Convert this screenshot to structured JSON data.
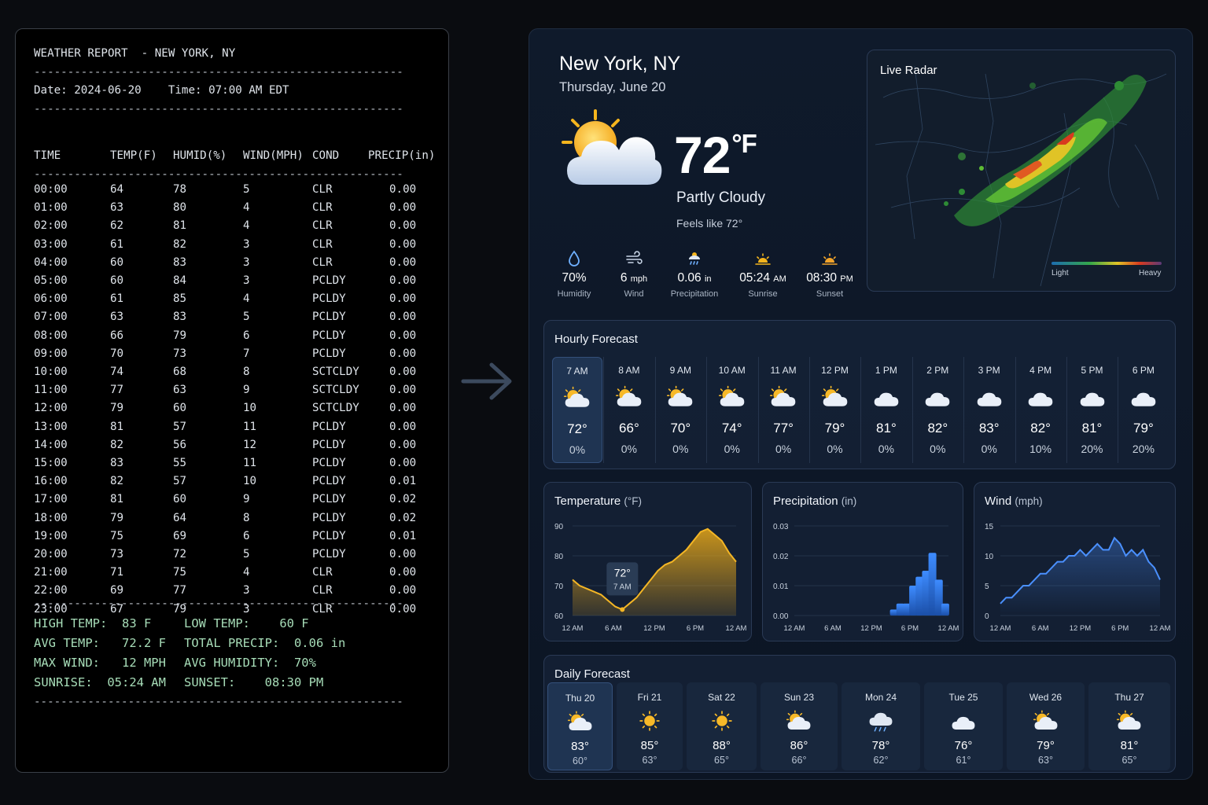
{
  "terminal": {
    "title": "WEATHER REPORT  - NEW YORK, NY",
    "separator": "-------------------------------------------------------",
    "date_line": "Date: 2024-06-20    Time: 07:00 AM EDT",
    "headers": [
      "TIME",
      "TEMP(F)",
      "HUMID(%)",
      "WIND(MPH)",
      "COND",
      "PRECIP(in)"
    ],
    "rows": [
      [
        "00:00",
        "64",
        "78",
        "5",
        "CLR",
        "0.00"
      ],
      [
        "01:00",
        "63",
        "80",
        "4",
        "CLR",
        "0.00"
      ],
      [
        "02:00",
        "62",
        "81",
        "4",
        "CLR",
        "0.00"
      ],
      [
        "03:00",
        "61",
        "82",
        "3",
        "CLR",
        "0.00"
      ],
      [
        "04:00",
        "60",
        "83",
        "3",
        "CLR",
        "0.00"
      ],
      [
        "05:00",
        "60",
        "84",
        "3",
        "PCLDY",
        "0.00"
      ],
      [
        "06:00",
        "61",
        "85",
        "4",
        "PCLDY",
        "0.00"
      ],
      [
        "07:00",
        "63",
        "83",
        "5",
        "PCLDY",
        "0.00"
      ],
      [
        "08:00",
        "66",
        "79",
        "6",
        "PCLDY",
        "0.00"
      ],
      [
        "09:00",
        "70",
        "73",
        "7",
        "PCLDY",
        "0.00"
      ],
      [
        "10:00",
        "74",
        "68",
        "8",
        "SCTCLDY",
        "0.00"
      ],
      [
        "11:00",
        "77",
        "63",
        "9",
        "SCTCLDY",
        "0.00"
      ],
      [
        "12:00",
        "79",
        "60",
        "10",
        "SCTCLDY",
        "0.00"
      ],
      [
        "13:00",
        "81",
        "57",
        "11",
        "PCLDY",
        "0.00"
      ],
      [
        "14:00",
        "82",
        "56",
        "12",
        "PCLDY",
        "0.00"
      ],
      [
        "15:00",
        "83",
        "55",
        "11",
        "PCLDY",
        "0.00"
      ],
      [
        "16:00",
        "82",
        "57",
        "10",
        "PCLDY",
        "0.01"
      ],
      [
        "17:00",
        "81",
        "60",
        "9",
        "PCLDY",
        "0.02"
      ],
      [
        "18:00",
        "79",
        "64",
        "8",
        "PCLDY",
        "0.02"
      ],
      [
        "19:00",
        "75",
        "69",
        "6",
        "PCLDY",
        "0.01"
      ],
      [
        "20:00",
        "73",
        "72",
        "5",
        "PCLDY",
        "0.00"
      ],
      [
        "21:00",
        "71",
        "75",
        "4",
        "CLR",
        "0.00"
      ],
      [
        "22:00",
        "69",
        "77",
        "3",
        "CLR",
        "0.00"
      ],
      [
        "23:00",
        "67",
        "79",
        "3",
        "CLR",
        "0.00"
      ]
    ],
    "summary": [
      [
        "HIGH TEMP:  83 F",
        "LOW TEMP:    60 F"
      ],
      [
        "AVG TEMP:   72.2 F",
        "TOTAL PRECIP:  0.06 in"
      ],
      [
        "MAX WIND:   12 MPH",
        "AVG HUMIDITY:  70%"
      ],
      [
        "SUNRISE:  05:24 AM",
        "SUNSET:    08:30 PM"
      ]
    ]
  },
  "current": {
    "city": "New York, NY",
    "date": "Thursday, June 20",
    "temp": "72",
    "temp_unit": "°F",
    "condition": "Partly Cloudy",
    "feels_like": "Feels like 72°",
    "icon": "partly-cloudy-icon",
    "stats": [
      {
        "icon": "humidity-icon",
        "value": "70%",
        "unit": "",
        "label": "Humidity"
      },
      {
        "icon": "wind-icon",
        "value": "6",
        "unit": "mph",
        "label": "Wind"
      },
      {
        "icon": "precipitation-icon",
        "value": "0.06",
        "unit": "in",
        "label": "Precipitation"
      },
      {
        "icon": "sunrise-icon",
        "value": "05:24",
        "unit": "AM",
        "label": "Sunrise"
      },
      {
        "icon": "sunset-icon",
        "value": "08:30",
        "unit": "PM",
        "label": "Sunset"
      }
    ]
  },
  "radar": {
    "title": "Live Radar",
    "legend_light": "Light",
    "legend_heavy": "Heavy"
  },
  "hourly": {
    "title": "Hourly Forecast",
    "items": [
      {
        "time": "7 AM",
        "temp": "72°",
        "precip": "0%",
        "icon": "partly-cloudy-icon"
      },
      {
        "time": "8 AM",
        "temp": "66°",
        "precip": "0%",
        "icon": "partly-cloudy-icon"
      },
      {
        "time": "9 AM",
        "temp": "70°",
        "precip": "0%",
        "icon": "partly-cloudy-icon"
      },
      {
        "time": "10 AM",
        "temp": "74°",
        "precip": "0%",
        "icon": "partly-cloudy-icon"
      },
      {
        "time": "11 AM",
        "temp": "77°",
        "precip": "0%",
        "icon": "partly-cloudy-icon"
      },
      {
        "time": "12 PM",
        "temp": "79°",
        "precip": "0%",
        "icon": "partly-cloudy-icon"
      },
      {
        "time": "1 PM",
        "temp": "81°",
        "precip": "0%",
        "icon": "cloudy-icon"
      },
      {
        "time": "2 PM",
        "temp": "82°",
        "precip": "0%",
        "icon": "cloudy-icon"
      },
      {
        "time": "3 PM",
        "temp": "83°",
        "precip": "0%",
        "icon": "cloudy-icon"
      },
      {
        "time": "4 PM",
        "temp": "82°",
        "precip": "10%",
        "icon": "cloudy-icon"
      },
      {
        "time": "5 PM",
        "temp": "81°",
        "precip": "20%",
        "icon": "cloudy-icon"
      },
      {
        "time": "6 PM",
        "temp": "79°",
        "precip": "20%",
        "icon": "cloudy-icon"
      }
    ]
  },
  "charts": {
    "temperature": {
      "title": "Temperature",
      "unit": "(°F)",
      "tooltip_value": "72°",
      "tooltip_time": "7 AM"
    },
    "precipitation": {
      "title": "Precipitation",
      "unit": "(in)"
    },
    "wind": {
      "title": "Wind",
      "unit": "(mph)"
    }
  },
  "chart_data": [
    {
      "type": "area",
      "title": "Temperature (°F)",
      "x": [
        "00:00",
        "01:00",
        "02:00",
        "03:00",
        "04:00",
        "05:00",
        "06:00",
        "07:00",
        "08:00",
        "09:00",
        "10:00",
        "11:00",
        "12:00",
        "13:00",
        "14:00",
        "15:00",
        "16:00",
        "17:00",
        "18:00",
        "19:00",
        "20:00",
        "21:00",
        "22:00",
        "23:00"
      ],
      "values": [
        72,
        70,
        69,
        68,
        67,
        65,
        63,
        62,
        64,
        66,
        69,
        72,
        75,
        77,
        78,
        80,
        82,
        85,
        88,
        89,
        87,
        85,
        81,
        78
      ],
      "ylim": [
        60,
        90
      ],
      "yticks": [
        "90",
        "80",
        "70",
        "60"
      ],
      "xticks": [
        "12 AM",
        "6 AM",
        "12 PM",
        "6 PM",
        "12 AM"
      ],
      "color": "#e8a818"
    },
    {
      "type": "bar",
      "title": "Precipitation (in)",
      "x": [
        "15:00",
        "16:00",
        "17:00",
        "18:00",
        "19:00",
        "20:00",
        "21:00",
        "22:00",
        "23:00"
      ],
      "values": [
        0.002,
        0.004,
        0.004,
        0.01,
        0.013,
        0.015,
        0.021,
        0.012,
        0.004
      ],
      "ylim": [
        0,
        0.03
      ],
      "yticks": [
        "0.03",
        "0.02",
        "0.01",
        "0.00"
      ],
      "xticks": [
        "12 AM",
        "6 AM",
        "12 PM",
        "6 PM",
        "12 AM"
      ],
      "color": "#2f7df0"
    },
    {
      "type": "line",
      "title": "Wind (mph)",
      "values": [
        2,
        3,
        3,
        4,
        5,
        5,
        6,
        7,
        7,
        8,
        9,
        9,
        10,
        10,
        11,
        10,
        11,
        12,
        11,
        11,
        13,
        12,
        10,
        11,
        10,
        11,
        9,
        8,
        6
      ],
      "ylim": [
        0,
        15
      ],
      "yticks": [
        "15",
        "10",
        "5",
        "0"
      ],
      "xticks": [
        "12 AM",
        "6 AM",
        "12 PM",
        "6 PM",
        "12 AM"
      ],
      "color": "#4a90ff"
    }
  ],
  "daily": {
    "title": "Daily Forecast",
    "items": [
      {
        "day": "Thu 20",
        "hi": "83°",
        "lo": "60°",
        "icon": "partly-cloudy-icon"
      },
      {
        "day": "Fri 21",
        "hi": "85°",
        "lo": "63°",
        "icon": "sunny-icon"
      },
      {
        "day": "Sat 22",
        "hi": "88°",
        "lo": "65°",
        "icon": "sunny-icon"
      },
      {
        "day": "Sun 23",
        "hi": "86°",
        "lo": "66°",
        "icon": "partly-cloudy-icon"
      },
      {
        "day": "Mon 24",
        "hi": "78°",
        "lo": "62°",
        "icon": "rain-icon"
      },
      {
        "day": "Tue 25",
        "hi": "76°",
        "lo": "61°",
        "icon": "cloudy-icon"
      },
      {
        "day": "Wed 26",
        "hi": "79°",
        "lo": "63°",
        "icon": "partly-cloudy-icon"
      },
      {
        "day": "Thu 27",
        "hi": "81°",
        "lo": "65°",
        "icon": "partly-cloudy-icon"
      }
    ]
  }
}
